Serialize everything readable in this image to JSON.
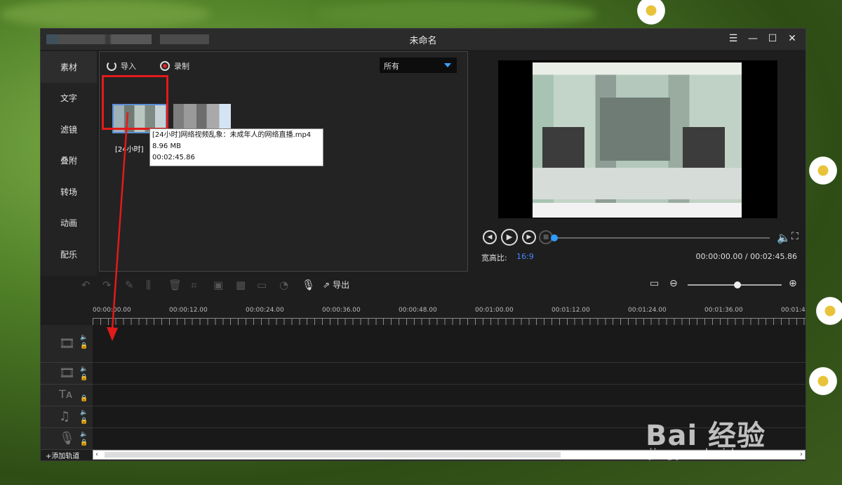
{
  "window": {
    "title": "未命名"
  },
  "sidebar": {
    "items": [
      {
        "label": "素材"
      },
      {
        "label": "文字"
      },
      {
        "label": "滤镜"
      },
      {
        "label": "叠附"
      },
      {
        "label": "转场"
      },
      {
        "label": "动画"
      },
      {
        "label": "配乐"
      }
    ]
  },
  "media": {
    "import_label": "导入",
    "record_label": "录制",
    "filter_value": "所有",
    "thumb1_label": "[24小时]",
    "tooltip": {
      "name": "[24小时]网络视频乱象：未成年人的网络直播.mp4",
      "size": "8.96 MB",
      "duration": "00:02:45.86"
    }
  },
  "preview": {
    "ratio_label": "宽高比:",
    "ratio_value": "16:9",
    "timecode": "00:00:00.00 / 00:02:45.86",
    "progress": 0
  },
  "toolbar": {
    "export_label": "导出",
    "zoom_level": 0.53
  },
  "ruler": {
    "ticks": [
      "00:00:00.00",
      "00:00:12.00",
      "00:00:24.00",
      "00:00:36.00",
      "00:00:48.00",
      "00:01:00.00",
      "00:01:12.00",
      "00:01:24.00",
      "00:01:36.00",
      "00:01:4"
    ]
  },
  "timeline": {
    "add_track_label": "+添加轨道"
  },
  "watermark": {
    "brand": "Bai 经验",
    "url": "jingyan.baidu.com"
  },
  "colors": {
    "accent": "#2e9bff",
    "highlight": "#e21a1a",
    "ratio": "#4d84ff"
  }
}
